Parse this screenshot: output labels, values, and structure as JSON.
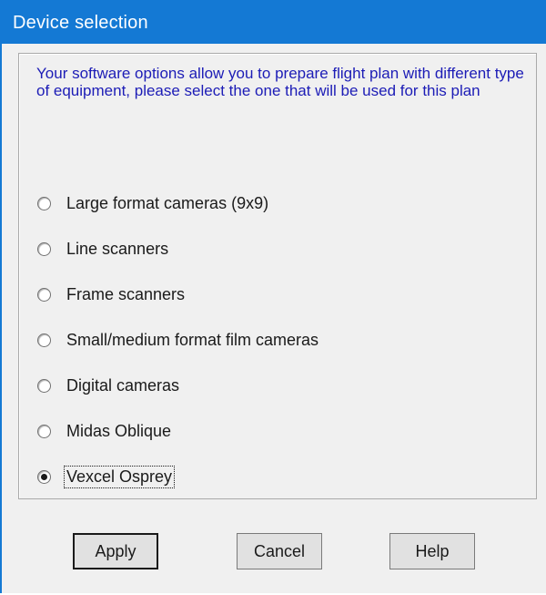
{
  "window": {
    "title": "Device selection"
  },
  "group": {
    "intro_text": "Your software options allow you to prepare flight plan with different type of equipment, please select the one that will be used for this plan",
    "options": [
      {
        "label": "Large format cameras (9x9)",
        "checked": false
      },
      {
        "label": "Line scanners",
        "checked": false
      },
      {
        "label": "Frame scanners",
        "checked": false
      },
      {
        "label": "Small/medium format film cameras",
        "checked": false
      },
      {
        "label": "Digital cameras",
        "checked": false
      },
      {
        "label": "Midas Oblique",
        "checked": false
      },
      {
        "label": "Vexcel Osprey",
        "checked": true
      }
    ]
  },
  "buttons": {
    "apply": "Apply",
    "cancel": "Cancel",
    "help": "Help"
  },
  "colors": {
    "titlebar": "#1479d4",
    "intro_text": "#1c1cb6",
    "dialog_background": "#f0f0f0"
  }
}
